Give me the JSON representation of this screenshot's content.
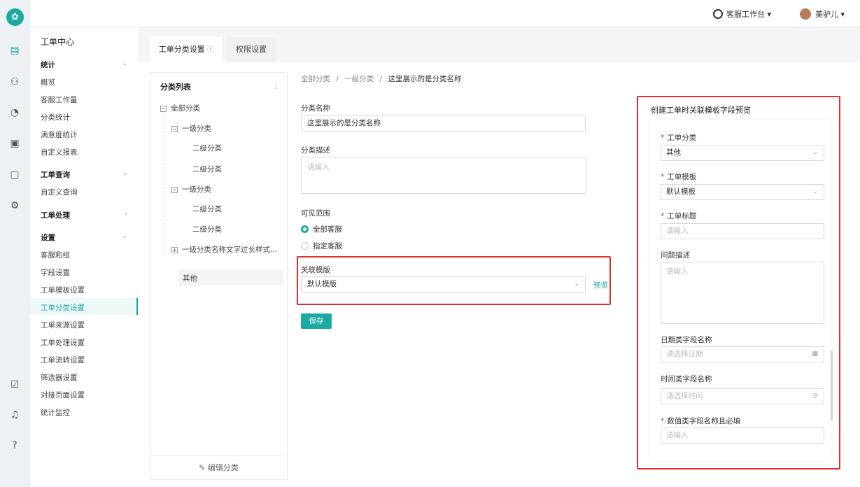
{
  "rail": {
    "logo": "tooth-logo",
    "icons": [
      "clipboard-icon",
      "people-icon",
      "gauge-icon",
      "monitor-icon",
      "screen-icon",
      "user-gear-icon",
      "calendar-check-icon",
      "bell-icon",
      "help-icon"
    ]
  },
  "topbar": {
    "workbench": "客服工作台",
    "user": "美驴儿"
  },
  "sidebar": {
    "title": "工单中心",
    "groups": [
      {
        "label": "统计",
        "items": [
          "概览",
          "客服工作量",
          "分类统计",
          "满意度统计",
          "自定义报表"
        ]
      },
      {
        "label": "工单查询",
        "items": [
          "自定义查询"
        ]
      },
      {
        "label": "工单处理",
        "items": []
      },
      {
        "label": "设置",
        "items": [
          "客服和组",
          "字段设置",
          "工单模板设置",
          "工单分类设置",
          "工单来源设置",
          "工单处理设置",
          "工单流转设置",
          "筛选器设置",
          "对接页面设置",
          "统计监控"
        ]
      }
    ],
    "active": "工单分类设置"
  },
  "tabs": {
    "active": "工单分类设置",
    "other": "权限设置"
  },
  "tree": {
    "header": "分类列表",
    "root": "全部分类",
    "nodes": [
      "一级分类",
      "二级分类",
      "二级分类",
      "一级分类",
      "二级分类",
      "二级分类",
      "一级分类名称文字过长样式...",
      "其他"
    ],
    "footer": "编辑分类"
  },
  "breadcrumb": {
    "a": "全部分类",
    "b": "一级分类",
    "c": "这里展示的是分类名称",
    "sep": "/"
  },
  "form": {
    "name_label": "分类名称",
    "name_value": "这里展示的是分类名称",
    "desc_label": "分类描述",
    "desc_ph": "请输入",
    "scope_label": "可见范围",
    "opt_all": "全部客服",
    "opt_spec": "指定客服",
    "tpl_label": "关联模版",
    "tpl_value": "默认模版",
    "preview_link": "预览",
    "save": "保存"
  },
  "preview": {
    "title": "创建工单时关联模板字段预览",
    "fields": {
      "f1_label": "工单分类",
      "f1_value": "其他",
      "f2_label": "工单模板",
      "f2_value": "默认模板",
      "f3_label": "工单标题",
      "f3_ph": "请输入",
      "f4_label": "问题描述",
      "f4_ph": "请输入",
      "f5_label": "日期类字段名称",
      "f5_ph": "请选择日期",
      "f6_label": "时间类字段名称",
      "f6_ph": "请选择时间",
      "f7_label": "数值类字段名称且必填",
      "f7_ph": "请输入"
    }
  },
  "colors": {
    "accent": "#1ba9a3",
    "highlight": "#e03030"
  }
}
